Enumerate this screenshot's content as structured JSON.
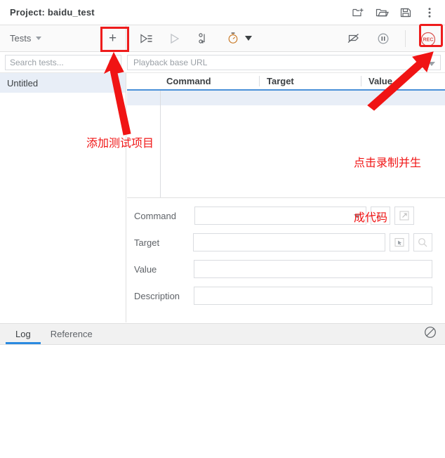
{
  "titlebar": {
    "project_label": "Project:  baidu_test",
    "actions": [
      {
        "name": "new-project-icon",
        "title": "New project"
      },
      {
        "name": "open-project-icon",
        "title": "Open project"
      },
      {
        "name": "save-project-icon",
        "title": "Save project"
      },
      {
        "name": "more-options-icon",
        "title": "More options"
      }
    ]
  },
  "toolbar": {
    "tests_label": "Tests",
    "add_test_label": "+",
    "buttons": [
      {
        "name": "run-all-tests-icon",
        "title": "Run all tests"
      },
      {
        "name": "run-current-test-icon",
        "title": "Run current test"
      },
      {
        "name": "step-over-icon",
        "title": "Step over"
      },
      {
        "name": "speed-control-icon",
        "title": "Test execution speed"
      },
      {
        "name": "disable-breakpoints-icon",
        "title": "Disable breakpoints"
      },
      {
        "name": "pause-on-exception-icon",
        "title": "Pause on exceptions"
      },
      {
        "name": "record-icon",
        "title": "REC",
        "label": "REC",
        "color": "#d9534f"
      }
    ]
  },
  "search": {
    "placeholder": "Search tests...",
    "value": "",
    "icon": "search-icon"
  },
  "playback_url": {
    "placeholder": "Playback base URL",
    "value": ""
  },
  "sidebar": {
    "tests": [
      {
        "label": "Untitled",
        "selected": true
      }
    ]
  },
  "table": {
    "columns": [
      "Command",
      "Target",
      "Value"
    ],
    "rows": [
      {
        "index": "",
        "command": "",
        "target": "",
        "value": ""
      }
    ]
  },
  "form": {
    "fields": [
      {
        "label": "Command",
        "value": "",
        "placeholder": ""
      },
      {
        "label": "Target",
        "value": "",
        "placeholder": ""
      },
      {
        "label": "Value",
        "value": "",
        "placeholder": ""
      },
      {
        "label": "Description",
        "value": "",
        "placeholder": ""
      }
    ],
    "command_comment_btn": "//",
    "buttons": [
      {
        "name": "add-comment-button",
        "label": "//"
      },
      {
        "name": "open-command-docs-button",
        "label": ""
      },
      {
        "name": "select-target-button",
        "label": ""
      },
      {
        "name": "find-target-button",
        "label": ""
      }
    ]
  },
  "log_panel": {
    "tabs": [
      {
        "label": "Log",
        "active": true
      },
      {
        "label": "Reference",
        "active": false
      }
    ],
    "clear_icon": "clear-log-icon",
    "content": ""
  },
  "annotations": [
    {
      "name": "annotation-add-test",
      "text": "添加测试项目",
      "color": "#f01414",
      "target": "add-test-button"
    },
    {
      "name": "annotation-record",
      "line1": "点击录制并生",
      "line2": "成代码",
      "color": "#f01414",
      "target": "record-button"
    }
  ],
  "colors": {
    "annotation_red": "#f01414",
    "highlight_red": "#ee1c1c",
    "accent_blue": "#2b8ae0",
    "selection_blue": "#e8eef7",
    "record_red": "#d9534f"
  }
}
